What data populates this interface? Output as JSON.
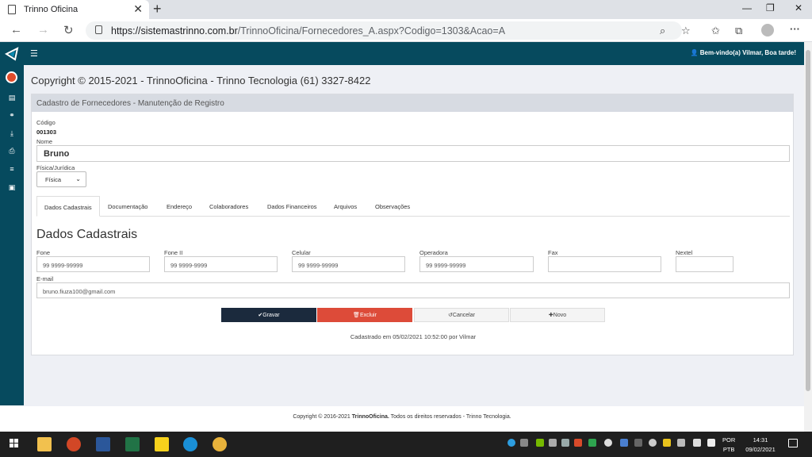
{
  "browser": {
    "tab_title": "Trinno Oficina",
    "url_host": "https://sistemastrinno.com.br",
    "url_path": "/TrinnoOficina/Fornecedores_A.aspx?Codigo=1303&Acao=A",
    "icons": [
      "back-icon",
      "forward-icon",
      "reload-icon",
      "lock-icon",
      "zoom-icon",
      "favorite-icon",
      "collections-icon",
      "extensions-icon",
      "profile-avatar",
      "menu-icon"
    ]
  },
  "app": {
    "welcome": "Bem-vindo(a) Vilmar, Boa tarde!",
    "copyright_header": "Copyright © 2015-2021 - TrinnoOficina - Trinno Tecnologia (61) 3327-8422",
    "card_title": "Cadastro de Fornecedores - Manutenção de Registro"
  },
  "sidebar": {
    "icons": [
      "logo-icon",
      "user-circle-icon",
      "database-icon",
      "share-icon",
      "download-icon",
      "print-icon",
      "list-icon",
      "calculator-icon"
    ]
  },
  "form": {
    "codigo_label": "Código",
    "codigo_value": "001303",
    "nome_label": "Nome",
    "nome_value": "Bruno",
    "tipo_label": "Física/Jurídica",
    "tipo_value": "Física"
  },
  "tabs": [
    "Dados Cadastrais",
    "Documentação",
    "Endereço",
    "Colaboradores",
    "Dados Financeiros",
    "Arquivos",
    "Observações"
  ],
  "section_title": "Dados Cadastrais",
  "fields": {
    "fone_label": "Fone",
    "fone_placeholder": "99 9999-99999",
    "fone2_label": "Fone II",
    "fone2_placeholder": "99 9999-9999",
    "celular_label": "Celular",
    "celular_placeholder": "99 9999-99999",
    "operadora_label": "Operadora",
    "operadora_placeholder": "99 9999-99999",
    "fax_label": "Fax",
    "fax_value": "",
    "nextel_label": "Nextel",
    "nextel_value": "",
    "email_label": "E-mail",
    "email_value": "bruno.fiuza100@gmail.com"
  },
  "buttons": {
    "gravar": "Gravar",
    "excluir": "Excluir",
    "cancelar": "Cancelar",
    "novo": "Novo"
  },
  "colors": {
    "nav": "#064a5e",
    "gravar": "#1b2a3d",
    "excluir": "#dd4b39",
    "bg": "#eef0f5"
  },
  "cadastro_info": "Cadastrado em 05/02/2021 10:52:00 por Vilmar",
  "footer": {
    "prefix": "Copyright © 2016-2021 ",
    "brand": "TrinnoOficina.",
    "suffix": " Todos os direitos reservados - Trinno Tecnologia."
  },
  "taskbar": {
    "lang1": "POR",
    "lang2": "PTB",
    "time": "14:31",
    "date": "09/02/2021"
  }
}
